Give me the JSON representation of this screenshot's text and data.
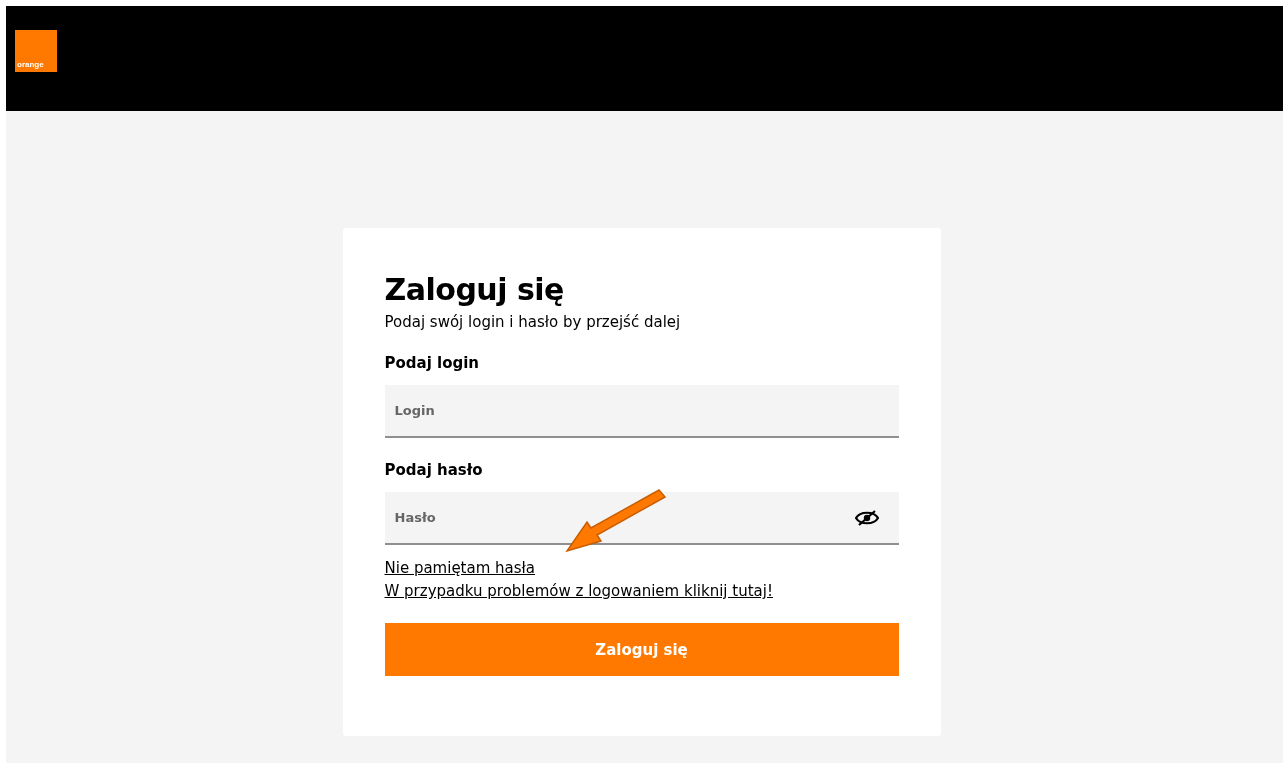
{
  "header": {
    "logo": "orange"
  },
  "login_form": {
    "title": "Zaloguj się",
    "subtitle": "Podaj swój login i hasło by przejść dalej",
    "fields": [
      {
        "label": "Podaj login",
        "placeholder": "Login",
        "kind": "text"
      },
      {
        "label": "Podaj hasło",
        "placeholder": "Hasło",
        "kind": "password"
      }
    ],
    "links": [
      "Nie pamiętam hasła",
      "W przypadku problemów z logowaniem kliknij tutaj!"
    ],
    "submit": "Zaloguj się"
  }
}
